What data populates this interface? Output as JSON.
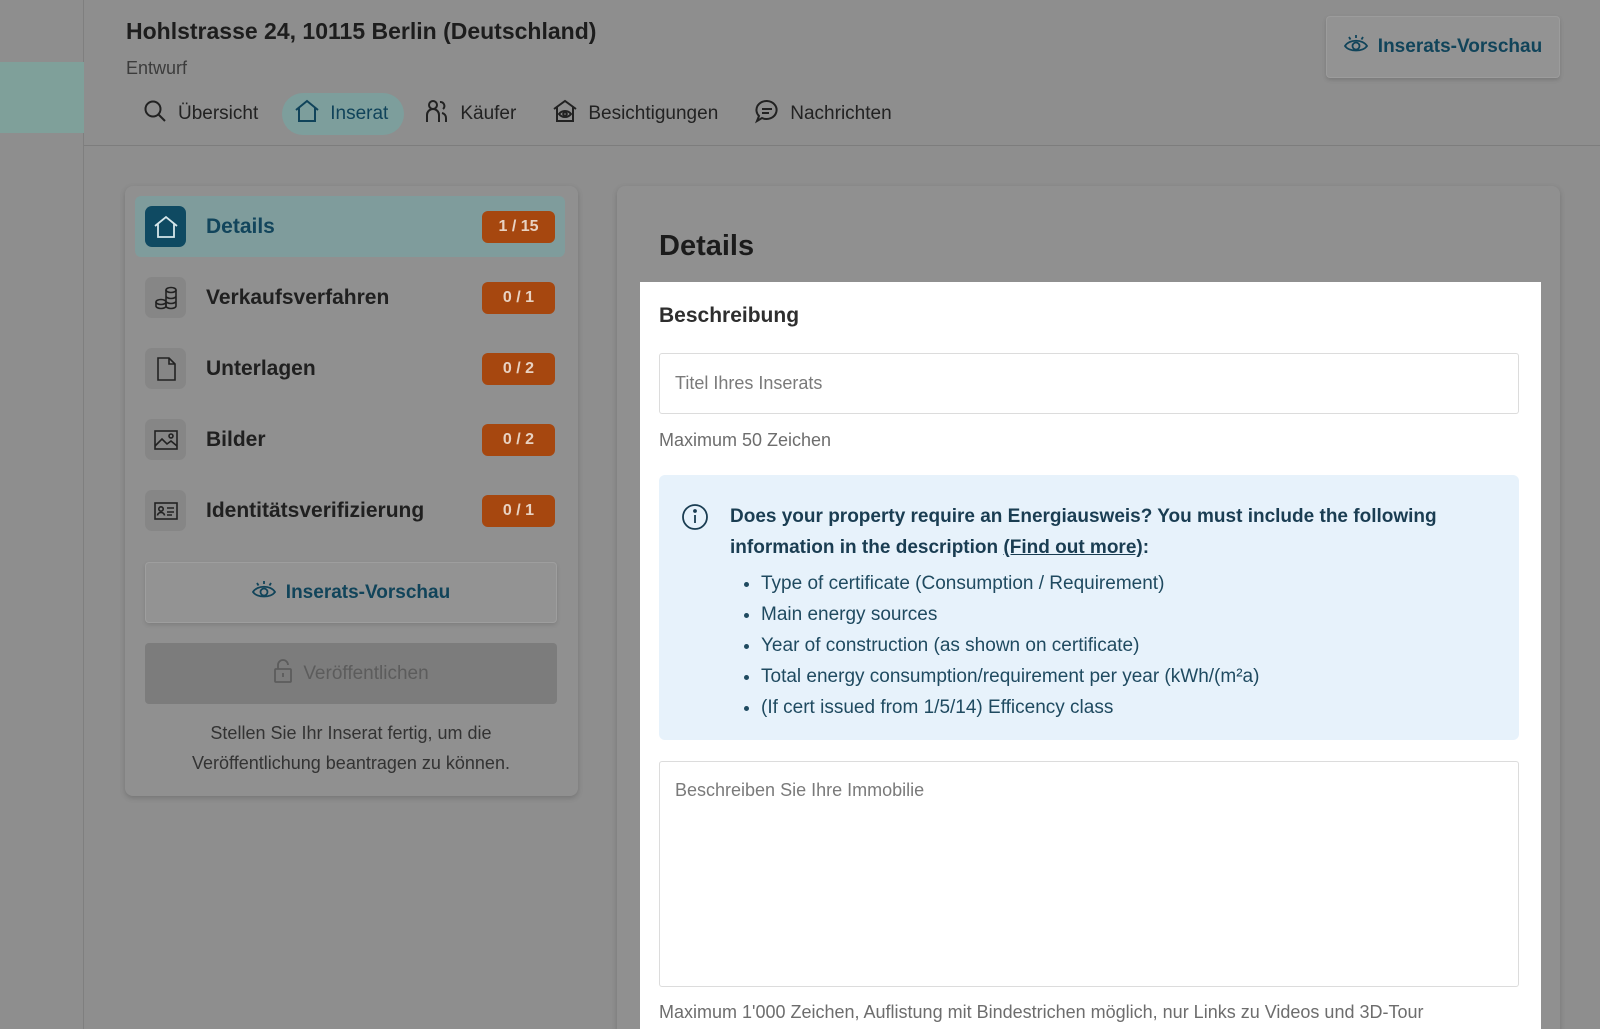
{
  "header": {
    "title": "Hohlstrasse 24, 10115 Berlin (Deutschland)",
    "status": "Entwurf",
    "preview_button": "Inserats-Vorschau"
  },
  "tabs": [
    {
      "label": "Übersicht",
      "icon": "search-icon",
      "active": false
    },
    {
      "label": "Inserat",
      "icon": "home-icon",
      "active": true
    },
    {
      "label": "Käufer",
      "icon": "users-icon",
      "active": false
    },
    {
      "label": "Besichtigungen",
      "icon": "eye-house-icon",
      "active": false
    },
    {
      "label": "Nachrichten",
      "icon": "chat-icon",
      "active": false
    }
  ],
  "sidebar": {
    "steps": [
      {
        "label": "Details",
        "badge": "1 / 15",
        "icon": "home-icon",
        "active": true
      },
      {
        "label": "Verkaufsverfahren",
        "badge": "0 / 1",
        "icon": "coins-icon",
        "active": false
      },
      {
        "label": "Unterlagen",
        "badge": "0 / 2",
        "icon": "document-icon",
        "active": false
      },
      {
        "label": "Bilder",
        "badge": "0 / 2",
        "icon": "image-icon",
        "active": false
      },
      {
        "label": "Identitätsverifizierung",
        "badge": "0 / 1",
        "icon": "id-card-icon",
        "active": false
      }
    ],
    "preview_button": "Inserats-Vorschau",
    "publish_button": "Veröffentlichen",
    "hint": "Stellen Sie Ihr Inserat fertig, um die Veröffentlichung beantragen zu können."
  },
  "main": {
    "title": "Details",
    "section_heading": "Beschreibung",
    "title_input": {
      "placeholder": "Titel Ihres Inserats",
      "value": ""
    },
    "title_hint": "Maximum 50 Zeichen",
    "info": {
      "text_before": "Does your property require an Energiausweis? You must include the following information in the description ",
      "link": "(Find out more)",
      "text_after": ":",
      "items": [
        "Type of certificate (Consumption / Requirement)",
        "Main energy sources",
        "Year of construction (as shown on certificate)",
        "Total energy consumption/requirement per year (kWh/(m²a)",
        "(If cert issued from 1/5/14) Efficency class"
      ]
    },
    "description_input": {
      "placeholder": "Beschreiben Sie Ihre Immobilie",
      "value": ""
    },
    "description_hint": "Maximum 1'000 Zeichen, Auflistung mit Bindestrichen möglich, nur Links zu Videos und 3D-Tour"
  },
  "colors": {
    "accent": "#12455c",
    "badge": "#a6470f",
    "info_bg": "#e7f2fb",
    "overlay": "#8e8e8e"
  }
}
